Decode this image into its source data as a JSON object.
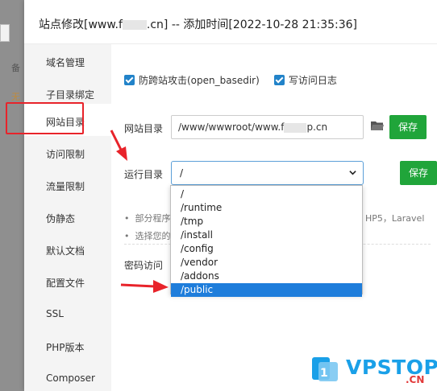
{
  "dialog": {
    "title_prefix": "站点修改[www.f",
    "title_suffix": ".cn] -- 添加时间[2022-10-28 21:35:36]"
  },
  "background": {
    "row1": "备",
    "row2": "无"
  },
  "sidebar": {
    "items": [
      {
        "label": "域名管理"
      },
      {
        "label": "子目录绑定"
      },
      {
        "label": "网站目录"
      },
      {
        "label": "访问限制"
      },
      {
        "label": "流量限制"
      },
      {
        "label": "伪静态"
      },
      {
        "label": "默认文档"
      },
      {
        "label": "配置文件"
      },
      {
        "label": "SSL"
      },
      {
        "label": "PHP版本"
      },
      {
        "label": "Composer"
      }
    ],
    "active_index": 2
  },
  "options": {
    "anti_cross": "防跨站攻击(open_basedir)",
    "access_log": "写访问日志"
  },
  "site_dir": {
    "label": "网站目录",
    "value_prefix": "/www/wwwroot/www.f",
    "value_suffix": "p.cn",
    "save": "保存"
  },
  "run_dir": {
    "label": "运行目录",
    "value": "/",
    "save": "保存",
    "options": [
      "/",
      "/runtime",
      "/tmp",
      "/install",
      "/config",
      "/vendor",
      "/addons",
      "/public"
    ],
    "highlighted": 7
  },
  "notes": {
    "line1": "部分程序",
    "line1_right": "HP5，Laravel",
    "line2": "选择您的"
  },
  "password_label": "密码访问",
  "colors": {
    "accent_green": "#20a53a",
    "select_blue": "#1e7ddb",
    "highlight_red": "#e8232a"
  },
  "watermark": {
    "main": "VPSTOP",
    "sub": ".CN"
  }
}
